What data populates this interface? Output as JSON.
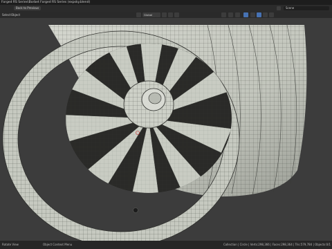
{
  "window": {
    "title": "Forged RS Series\\Borbet Forged RS Series (expsky.blend)"
  },
  "topbar": {
    "back_to_previous": "Back to Previous",
    "scene": "Scene"
  },
  "header": {
    "menu": [
      "Select",
      "Object"
    ],
    "orientation": "Global"
  },
  "statusbar": {
    "left": "Rotate View",
    "middle": "Object Context Menu",
    "stats": "Collection | Circle | Verts:298,366 | Faces:298,364 | Tris:579,784 | Objects:0/1"
  },
  "colors": {
    "background": "#3c3c3c",
    "mesh_fill": "#c8cbc2",
    "wire": "#2b2b2b",
    "header": "#2a2a2a"
  }
}
